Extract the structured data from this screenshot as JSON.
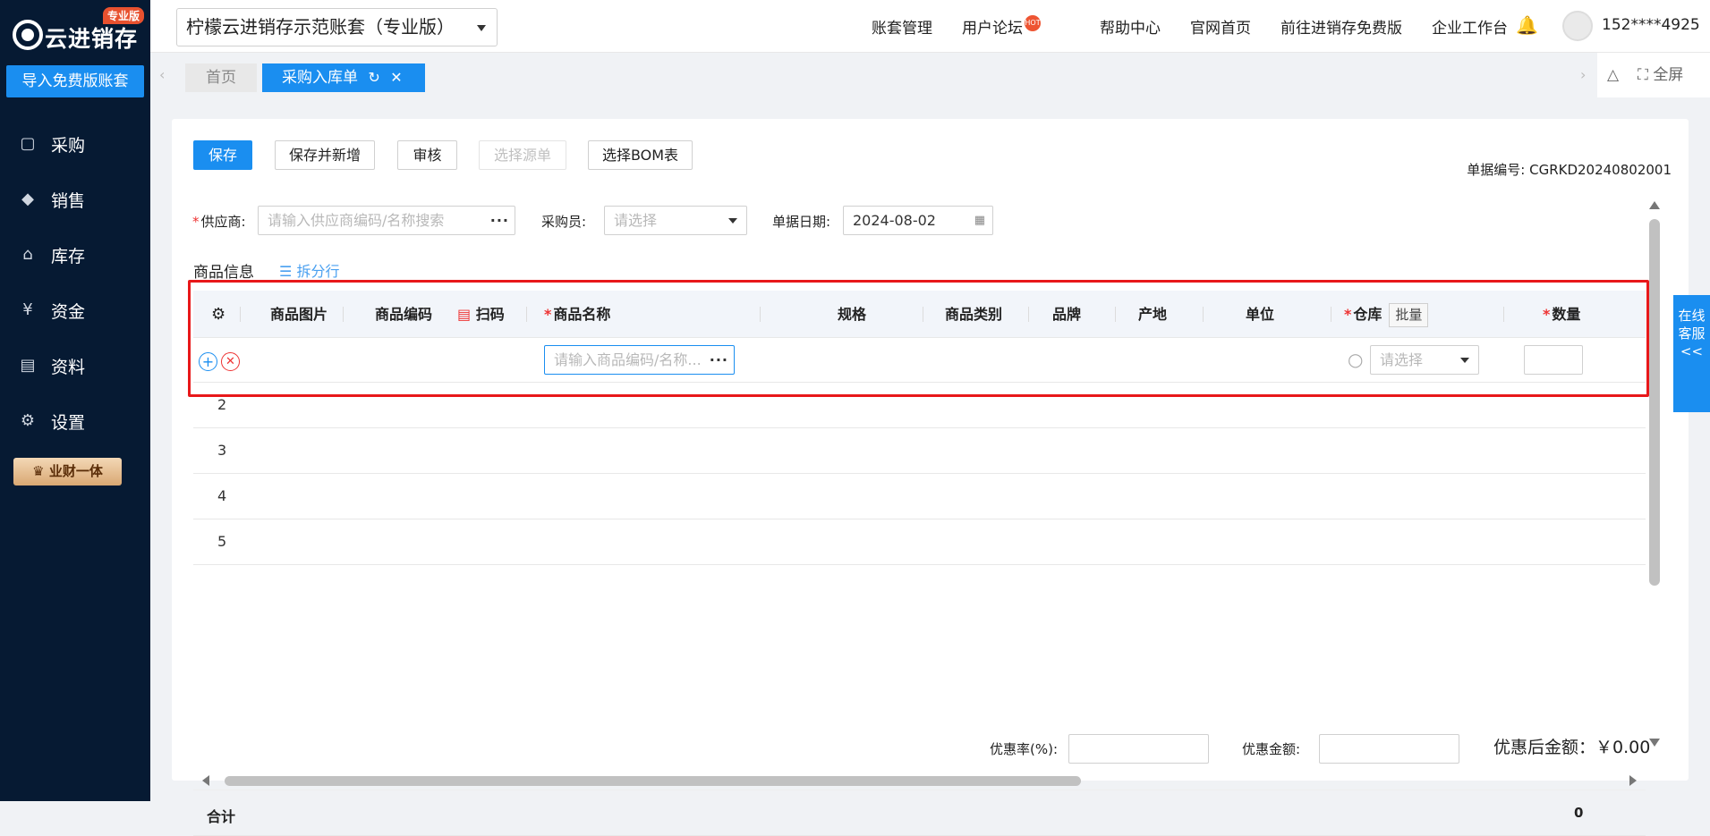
{
  "brand": {
    "name": "云进销存",
    "badge": "专业版",
    "import_button": "导入免费版账套"
  },
  "sidebar": {
    "items": [
      {
        "label": "采购",
        "icon": "bag-icon"
      },
      {
        "label": "销售",
        "icon": "sales-icon"
      },
      {
        "label": "库存",
        "icon": "warehouse-icon"
      },
      {
        "label": "资金",
        "icon": "yen-icon"
      },
      {
        "label": "资料",
        "icon": "document-icon"
      },
      {
        "label": "设置",
        "icon": "gear-icon"
      }
    ],
    "promo": "业财一体"
  },
  "header": {
    "account": "柠檬云进销存示范账套（专业版）",
    "nav": [
      "账套管理",
      "用户论坛",
      "帮助中心",
      "官网首页",
      "前往进销存免费版",
      "企业工作台"
    ],
    "hot_badge": "HOT",
    "user_phone": "152****4925"
  },
  "tabs": {
    "home": "首页",
    "active": "采购入库单",
    "fullscreen": "全屏"
  },
  "toolbar": {
    "save": "保存",
    "save_new": "保存并新增",
    "audit": "审核",
    "select_source": "选择源单",
    "select_bom": "选择BOM表",
    "doc_no": "单据编号: CGRKD20240802001"
  },
  "form": {
    "supplier_label": "供应商:",
    "supplier_placeholder": "请输入供应商编码/名称搜索",
    "buyer_label": "采购员:",
    "buyer_placeholder": "请选择",
    "date_label": "单据日期:",
    "date_value": "2024-08-02"
  },
  "section": {
    "title": "商品信息",
    "split": "拆分行"
  },
  "table": {
    "headers": {
      "image": "商品图片",
      "code": "商品编码",
      "scan": "扫码",
      "name": "商品名称",
      "spec": "规格",
      "category": "商品类别",
      "brand": "品牌",
      "origin": "产地",
      "unit": "单位",
      "warehouse": "仓库",
      "batch": "批量",
      "qty": "数量"
    },
    "row1": {
      "name_placeholder": "请输入商品编码/名称...",
      "warehouse_placeholder": "请选择"
    },
    "rows": [
      "2",
      "3",
      "4",
      "5"
    ],
    "total_label": "合计",
    "total_qty": "0"
  },
  "footer": {
    "discount_rate_label": "优惠率(%):",
    "discount_amount_label": "优惠金额:",
    "after_discount": "优惠后金额：￥0.00"
  },
  "customer_service": "在线客服<<"
}
